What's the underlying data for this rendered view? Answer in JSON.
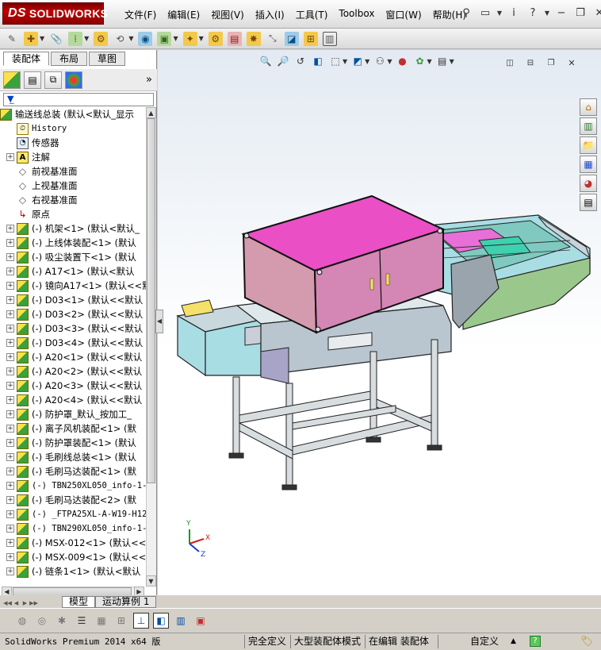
{
  "app": {
    "logo_text": "SOLIDWORKS",
    "logo_prefix": "DS"
  },
  "menus": [
    "文件(F)",
    "编辑(E)",
    "视图(V)",
    "插入(I)",
    "工具(T)",
    "Toolbox",
    "窗口(W)",
    "帮助(H)"
  ],
  "panel_tabs": [
    "装配体",
    "布局",
    "草图"
  ],
  "tree": {
    "root": "输送线总装  (默认<默认_显示",
    "items": [
      {
        "label": "History",
        "icon": "history-icon",
        "expandable": false,
        "mono": true
      },
      {
        "label": "传感器",
        "icon": "sensor-icon",
        "expandable": false
      },
      {
        "label": "注解",
        "icon": "annotation-icon",
        "expandable": true
      },
      {
        "label": "前视基准面",
        "icon": "plane-icon",
        "expandable": false
      },
      {
        "label": "上视基准面",
        "icon": "plane-icon",
        "expandable": false
      },
      {
        "label": "右视基准面",
        "icon": "plane-icon",
        "expandable": false
      },
      {
        "label": "原点",
        "icon": "origin-icon",
        "expandable": false
      },
      {
        "label": "(-) 机架<1> (默认<默认_",
        "icon": "assembly-icon",
        "expandable": true
      },
      {
        "label": "(-) 上线体装配<1> (默认",
        "icon": "assembly-icon",
        "expandable": true
      },
      {
        "label": "(-) 吸尘装置下<1> (默认",
        "icon": "assembly-icon",
        "expandable": true
      },
      {
        "label": "(-) A17<1> (默认<默认",
        "icon": "assembly-icon",
        "expandable": true
      },
      {
        "label": "(-) 镜向A17<1> (默认<<默",
        "icon": "assembly-icon",
        "expandable": true
      },
      {
        "label": "(-) D03<1> (默认<<默认",
        "icon": "assembly-icon",
        "expandable": true
      },
      {
        "label": "(-) D03<2> (默认<<默认",
        "icon": "assembly-icon",
        "expandable": true
      },
      {
        "label": "(-) D03<3> (默认<<默认",
        "icon": "assembly-icon",
        "expandable": true
      },
      {
        "label": "(-) D03<4> (默认<<默认",
        "icon": "assembly-icon",
        "expandable": true
      },
      {
        "label": "(-) A20<1> (默认<<默认",
        "icon": "assembly-icon",
        "expandable": true
      },
      {
        "label": "(-) A20<2> (默认<<默认",
        "icon": "assembly-icon",
        "expandable": true
      },
      {
        "label": "(-) A20<3> (默认<<默认",
        "icon": "assembly-icon",
        "expandable": true
      },
      {
        "label": "(-) A20<4> (默认<<默认",
        "icon": "assembly-icon",
        "expandable": true
      },
      {
        "label": "(-) 防护罩_默认_按加工_",
        "icon": "assembly-icon",
        "expandable": true
      },
      {
        "label": "(-) 离子风机装配<1> (默",
        "icon": "assembly-icon",
        "expandable": true
      },
      {
        "label": "(-) 防护罩装配<1> (默认",
        "icon": "assembly-icon",
        "expandable": true
      },
      {
        "label": "(-) 毛刷线总装<1> (默认",
        "icon": "assembly-icon",
        "expandable": true
      },
      {
        "label": "(-) 毛刷马达装配<1> (默",
        "icon": "assembly-icon",
        "expandable": true
      },
      {
        "label": "(-) TBN250XL050_info-1-",
        "icon": "assembly-icon",
        "expandable": true,
        "mono": true
      },
      {
        "label": "(-) 毛刷马达装配<2> (默",
        "icon": "assembly-icon",
        "expandable": true
      },
      {
        "label": "(-) _FTPA25XL-A-W19-H12",
        "icon": "assembly-icon",
        "expandable": true,
        "mono": true
      },
      {
        "label": "(-) TBN290XL050_info-1-",
        "icon": "assembly-icon",
        "expandable": true,
        "mono": true
      },
      {
        "label": "(-) MSX-012<1> (默认<<默",
        "icon": "assembly-icon",
        "expandable": true
      },
      {
        "label": "(-) MSX-009<1> (默认<<默",
        "icon": "assembly-icon",
        "expandable": true
      },
      {
        "label": "(-) 链条1<1> (默认<默认",
        "icon": "assembly-icon",
        "expandable": true
      }
    ]
  },
  "bottom_tabs": [
    "模型",
    "运动算例 1"
  ],
  "status": {
    "version": "SolidWorks Premium 2014 x64 版",
    "defined": "完全定义",
    "mode": "大型装配体模式",
    "editing": "在编辑 装配体",
    "custom": "自定义"
  },
  "triad": {
    "x": "X",
    "y": "Y",
    "z": "Z"
  },
  "colors": {
    "brand": "#a00000",
    "enclosure_pink": "#e85bb8",
    "frame_gray": "#b8c4cc",
    "conveyor_cyan": "#a8e0e8",
    "guard_green": "#98c890"
  }
}
